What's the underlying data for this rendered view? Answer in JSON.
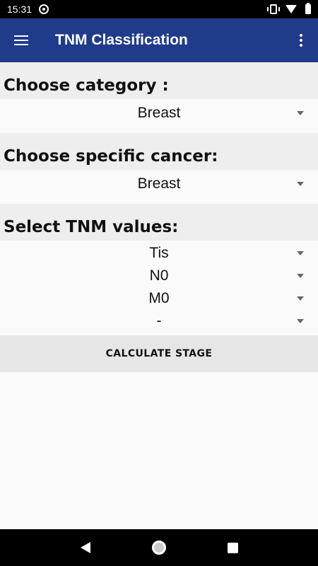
{
  "status": {
    "time": "15:31"
  },
  "app_bar": {
    "title": "TNM Classification"
  },
  "sections": {
    "category": {
      "label": "Choose category :",
      "value": "Breast"
    },
    "cancer": {
      "label": "Choose specific cancer:",
      "value": "Breast"
    },
    "tnm": {
      "label": "Select TNM values:",
      "t_value": "Tis",
      "n_value": "N0",
      "m_value": "M0",
      "extra_value": "-"
    }
  },
  "calculate_button": "CALCULATE STAGE",
  "colors": {
    "app_bar": "#1f3b8a",
    "section_bg": "#eeeeee",
    "button_bg": "#e6e6e6"
  },
  "icons": [
    "menu-icon",
    "overflow-menu-icon",
    "dropdown-arrow-icon",
    "back-icon",
    "home-icon",
    "recent-apps-icon"
  ]
}
